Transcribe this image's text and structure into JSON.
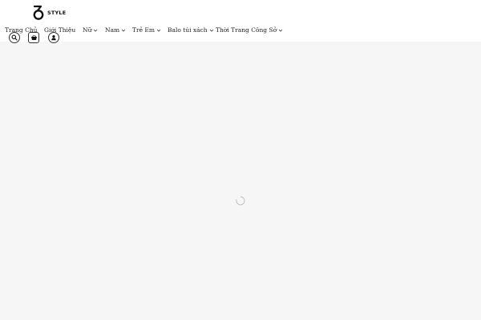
{
  "brand": {
    "logo_text": "STYLE"
  },
  "nav": {
    "items": [
      {
        "label": "Trang Chủ",
        "dropdown": false
      },
      {
        "label": "Giới Thiệu",
        "dropdown": false
      },
      {
        "label": "Nữ",
        "dropdown": true
      },
      {
        "label": "Nam",
        "dropdown": true
      },
      {
        "label": "Trẻ Em",
        "dropdown": true
      },
      {
        "label": "Balo túi xách",
        "dropdown": true
      },
      {
        "label": "Thời Trang Công Sở",
        "dropdown": true
      }
    ]
  },
  "header_icons": [
    "search-icon",
    "basket-icon",
    "user-icon"
  ],
  "colors": {
    "header_bg": "#ffffff",
    "page_bg": "#f6f6f6",
    "text": "#222222"
  }
}
